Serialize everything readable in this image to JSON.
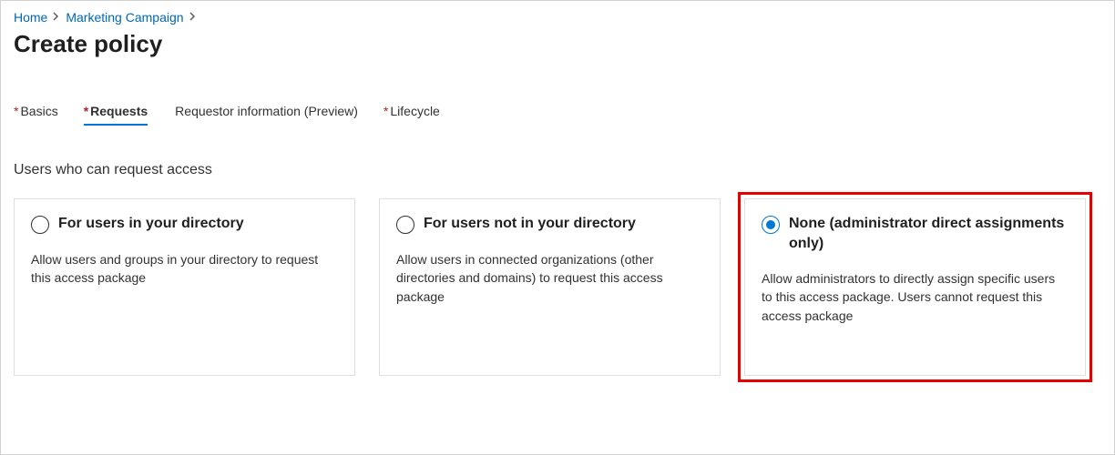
{
  "breadcrumb": {
    "items": [
      {
        "label": "Home"
      },
      {
        "label": "Marketing Campaign"
      }
    ]
  },
  "page_title": "Create policy",
  "tabs": [
    {
      "label": "Basics",
      "asterisk": "*",
      "active": false
    },
    {
      "label": "Requests",
      "asterisk": "*",
      "active": true
    },
    {
      "label": "Requestor information (Preview)",
      "asterisk": "",
      "active": false
    },
    {
      "label": "Lifecycle",
      "asterisk": "*",
      "active": false
    }
  ],
  "section_label": "Users who can request access",
  "options": [
    {
      "title": "For users in your directory",
      "desc": "Allow users and groups in your directory to request this access package",
      "selected": false,
      "highlighted": false
    },
    {
      "title": "For users not in your directory",
      "desc": "Allow users in connected organizations (other directories and domains) to request this access package",
      "selected": false,
      "highlighted": false
    },
    {
      "title": "None (administrator direct assignments only)",
      "desc": "Allow administrators to directly assign specific users to this access package. Users cannot request this access package",
      "selected": true,
      "highlighted": true
    }
  ]
}
